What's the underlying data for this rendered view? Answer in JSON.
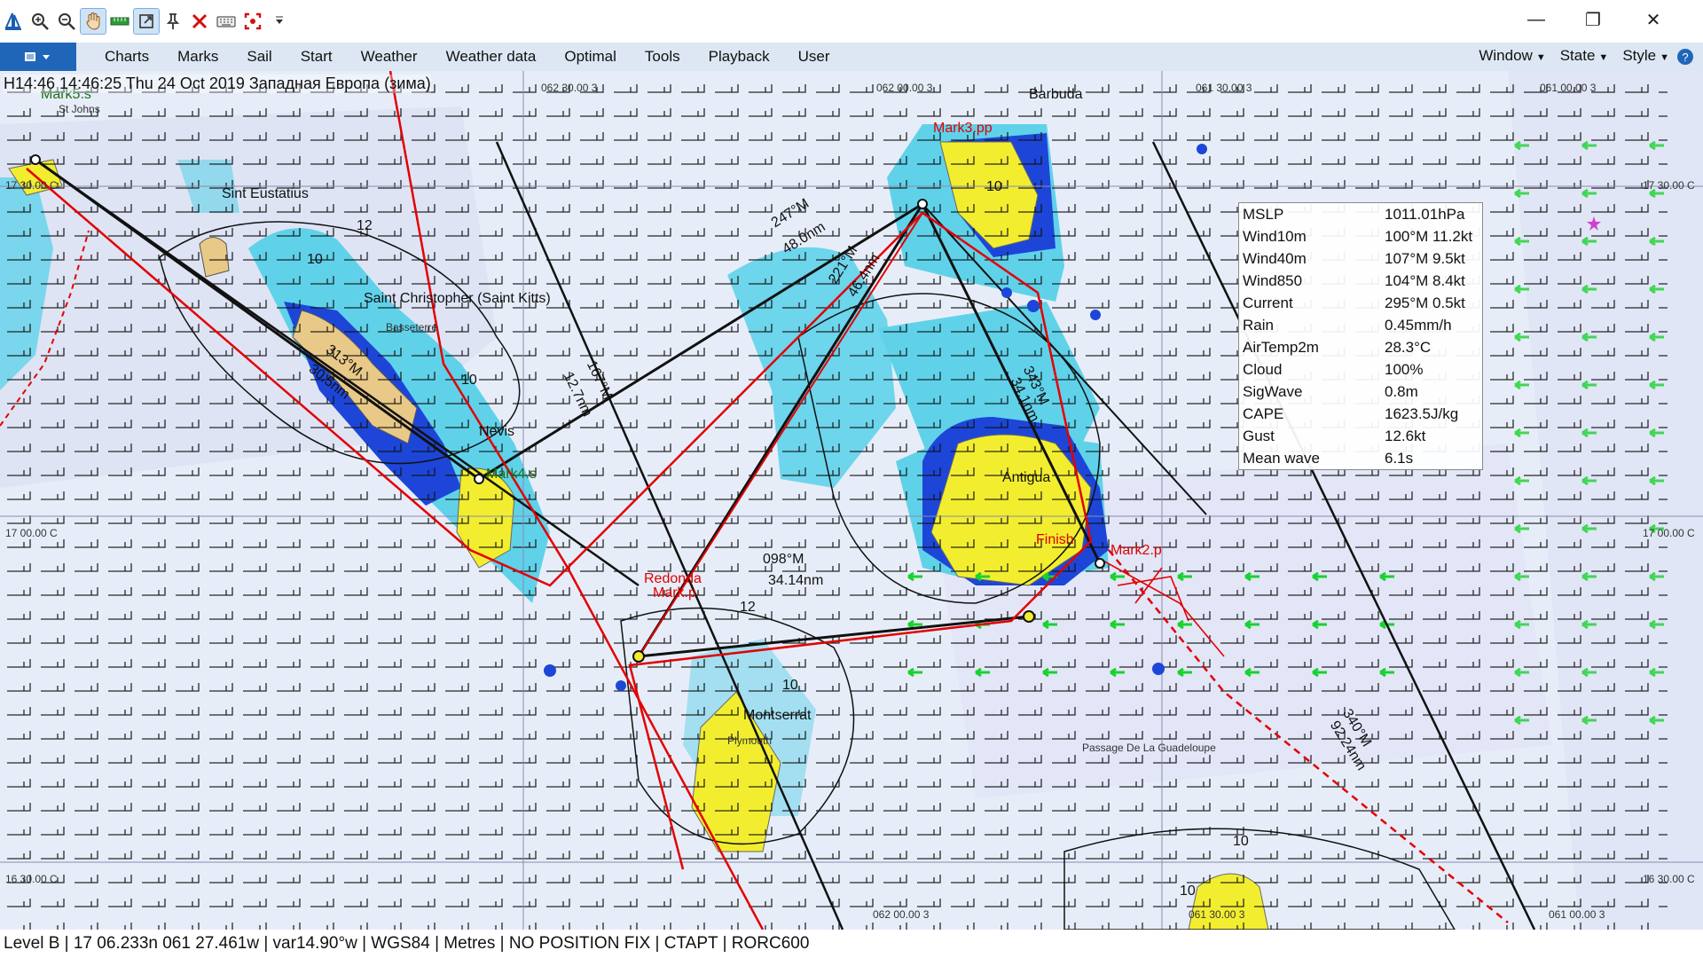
{
  "window": {
    "minimize": "—",
    "restore": "❐",
    "close": "✕"
  },
  "toolbar": {
    "tools": [
      "sail-logo-icon",
      "zoom-in-icon",
      "zoom-out-icon",
      "pan-hand-icon",
      "ruler-icon",
      "pin-icon",
      "resize-icon",
      "delete-icon",
      "keyboard-icon",
      "target-icon",
      "dropdown-icon"
    ]
  },
  "menu": {
    "items": [
      "Charts",
      "Marks",
      "Sail",
      "Start",
      "Weather",
      "Weather data",
      "Optimal",
      "Tools",
      "Playback",
      "User"
    ],
    "right": [
      "Window",
      "State",
      "Style"
    ]
  },
  "header": {
    "text": "H14:46 14:46:25 Thu 24 Oct 2019 Западная Европа (зима)"
  },
  "info": [
    {
      "k": "MSLP",
      "v": "1011.01hPa"
    },
    {
      "k": "Wind10m",
      "v": "100°M 11.2kt"
    },
    {
      "k": "Wind40m",
      "v": "107°M 9.5kt"
    },
    {
      "k": "Wind850",
      "v": "104°M 8.4kt"
    },
    {
      "k": "Current",
      "v": "295°M 0.5kt"
    },
    {
      "k": "Rain",
      "v": "0.45mm/h"
    },
    {
      "k": "AirTemp2m",
      "v": "28.3°C"
    },
    {
      "k": "Cloud",
      "v": "100%"
    },
    {
      "k": "SigWave",
      "v": "0.8m"
    },
    {
      "k": "CAPE",
      "v": "1623.5J/kg"
    },
    {
      "k": "Gust",
      "v": "12.6kt"
    },
    {
      "k": "Mean wave",
      "v": "6.1s"
    }
  ],
  "labels": {
    "mark5": "Mark5.s",
    "stjohns": "St Johns",
    "sinteustatius": "Sint Eustatius",
    "saintkitts": "Saint Christopher (Saint Kitts)",
    "basseterre": "Basseterre",
    "nevis": "Nevis",
    "mark4": "Mark4.s",
    "mark3": "Mark3.pp",
    "barbuda": "Barbuda",
    "antigua": "Antigua",
    "mark2": "Mark2.p",
    "finish": "Finish",
    "redonda": "Redonda",
    "redondamark": "Mark.p",
    "montserrat": "Montserrat",
    "plymouth": "Plymouth",
    "passage": "Passage De La Guadeloupe",
    "brg1": "247°M",
    "dist1": "48.0nm",
    "brg2": "221°M",
    "dist2": "46.4nm",
    "brg3": "313°M",
    "dist3": "30.5nm",
    "brg4": "167°M",
    "dist4": "12.7nm",
    "brg5": "098°M",
    "dist5": "34.14nm",
    "brg6": "340°M",
    "dist6": "92.24nm",
    "brg7": "343°M",
    "dist7": "34.1nm",
    "lat1": "17 30.00 C",
    "lat1r": "17 30.00 C",
    "lat2": "17 00.00 C",
    "lat2r": "17 00.00 C",
    "lat3": "16 30.00 C",
    "lat3r": "16 30.00 C",
    "lon1": "062 30.00 3",
    "lon2": "062 00.00 3",
    "lon3": "061 30.00 3",
    "lon4": "061 00.00 3",
    "lon4b": "061 00.00 3",
    "lon2b": "062 00.00 3",
    "lon3b": "061 30.00 3",
    "iso10a": "10",
    "iso12": "12",
    "iso10b": "10",
    "iso10c": "10",
    "iso10d": "10",
    "iso10e": "10",
    "iso12b": "12",
    "iso10f": "10"
  },
  "status": {
    "text": "Level B | 17 06.233n 061 27.461w | var14.90°w | WGS84 | Metres | NO POSITION FIX | CTAPT | RORC600"
  },
  "colors": {
    "sea": "#e7edf8",
    "shallow": "#5fd2ea",
    "deep": "#1d46d8",
    "land": "#e9c987",
    "yellow": "#f2ee2f",
    "route": "#e30000",
    "course": "#111111",
    "wind": "#111111",
    "current": "#19d22e"
  }
}
